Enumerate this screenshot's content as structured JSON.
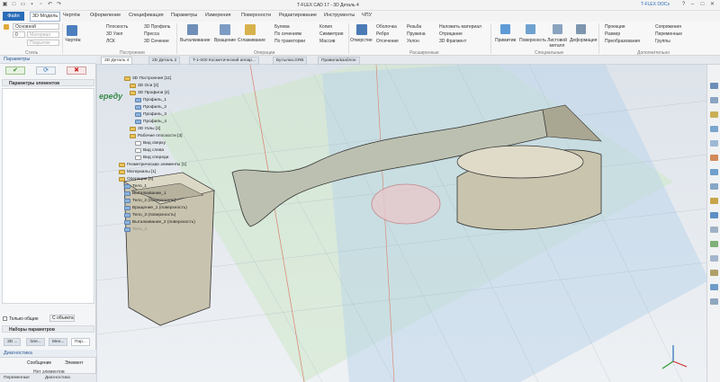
{
  "app": {
    "title": "T-FLEX CAD 17 - 3D Деталь 4",
    "docs_button": "T-FLEX DOCs"
  },
  "menu": [
    "Файл",
    "3D Модель",
    "Чертёж",
    "Оформление",
    "Спецификация",
    "Параметры",
    "Измерения",
    "Поверхности",
    "Редактирование",
    "Инструменты",
    "ЧПУ"
  ],
  "style_group": {
    "combo1": "Основной",
    "num": "0",
    "placeholder1": "Материал",
    "placeholder2": "Покрытие",
    "label": "Стиль"
  },
  "build_group": {
    "sketch": "Чертёж",
    "items": [
      "Плоскость",
      "3D Узел",
      "ЛСК",
      "3D Профиль",
      "Плоскость",
      "Пресса",
      "3D Путь",
      "3D Сечение"
    ],
    "label": "Построения"
  },
  "ops_group": {
    "big": [
      "Выталкивание",
      "Вращение",
      "Сглаживание"
    ],
    "items": [
      "Булева",
      "По сечениям",
      "По траектории",
      "Копия",
      "Симметрия",
      "Массив"
    ],
    "label": "Операции"
  },
  "ext_group": {
    "big": [
      "Отверстие"
    ],
    "items": [
      "Оболочка",
      "Ребро",
      "Отсечение",
      "Резьба",
      "Пружина",
      "Уклон",
      "Наложить материал",
      "Отрицание",
      "3D Фрагмент"
    ],
    "label": "Расширенные"
  },
  "spec_group": {
    "big": [
      "Примитив",
      "Поверхность",
      "Листовой металл",
      "Деформация"
    ],
    "label": "Специальные"
  },
  "extra_group": {
    "items": [
      "Проекция",
      "Размер",
      "Преобразования",
      "Сопряжения",
      "Переменные",
      "Группы"
    ],
    "label": "Дополнительно"
  },
  "doc_tabs": [
    "3D Деталь 4",
    "2D Деталь 2",
    "T-1-000 Косметический аппар...",
    "Бутылка.GRB",
    "Правила/Шаблон"
  ],
  "left_panel": {
    "title": "Параметры",
    "section": "Параметры элементов",
    "only_common": "Только общие",
    "from_object": "С объекта",
    "param_sets": "Наборы параметров",
    "mini_tabs": [
      "3D ...",
      "Эле...",
      "Мен...",
      "Пар..."
    ],
    "diag_title": "Диагностика",
    "diag_cols": [
      "Сообщение",
      "Элемент"
    ],
    "diag_empty": "Нет элементов",
    "bottom_tabs": [
      "Переменные",
      "Диагностика"
    ]
  },
  "tree": [
    "3D Построения [11]",
    "3D Оси [2]",
    "3D Профили [4]",
    "Профиль_1",
    "Профиль_2",
    "Профиль_3",
    "Профиль_4",
    "3D Узлы [2]",
    "Рабочие плоскости [3]",
    "Вид сверху",
    "Вид слева",
    "Вид спереди",
    "Геометрические элементы [1]",
    "Материалы [1]",
    "Операции [4]",
    "Тело_1",
    "Выталкивание_1",
    "Тело_2 (поверхность)",
    "Вращение_1 (поверхность)",
    "Тело_3 (поверхность)",
    "Выталкивание_2 (поверхность)",
    "Тело_4"
  ],
  "watermark": "ереду",
  "colors": {
    "accent": "#2b6cb8",
    "active_tab": "#ffffff",
    "model_face": "#cbc6b3",
    "plane_green": "#a9d6a1",
    "plane_blue": "#9fc0e0"
  }
}
